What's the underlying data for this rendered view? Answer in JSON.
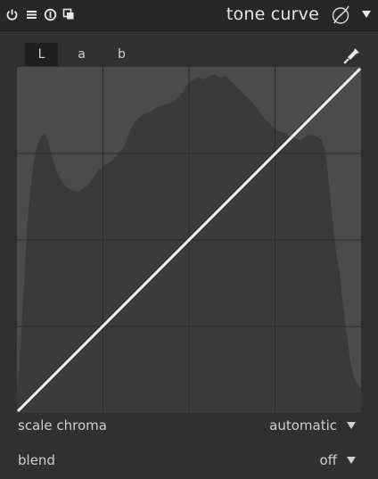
{
  "header": {
    "title": "tone curve",
    "icons": [
      "power-icon",
      "presets-menu-icon",
      "reset-icon",
      "multi-instance-icon",
      "display-mask-icon",
      "collapse-arrow-icon"
    ]
  },
  "tabs": [
    {
      "label": "L",
      "active": true
    },
    {
      "label": "a",
      "active": false
    },
    {
      "label": "b",
      "active": false
    }
  ],
  "picker_icon": "color-picker-icon",
  "graph": {
    "background": "#4a4a4a",
    "histogram_color": "#3a3a3a",
    "grid_color": "#2a2a2a",
    "curve_color": "#f2f2f2",
    "grid_divisions": 4
  },
  "rows": {
    "scale_chroma": {
      "label": "scale chroma",
      "value": "automatic"
    },
    "blend": {
      "label": "blend",
      "value": "off"
    }
  }
}
